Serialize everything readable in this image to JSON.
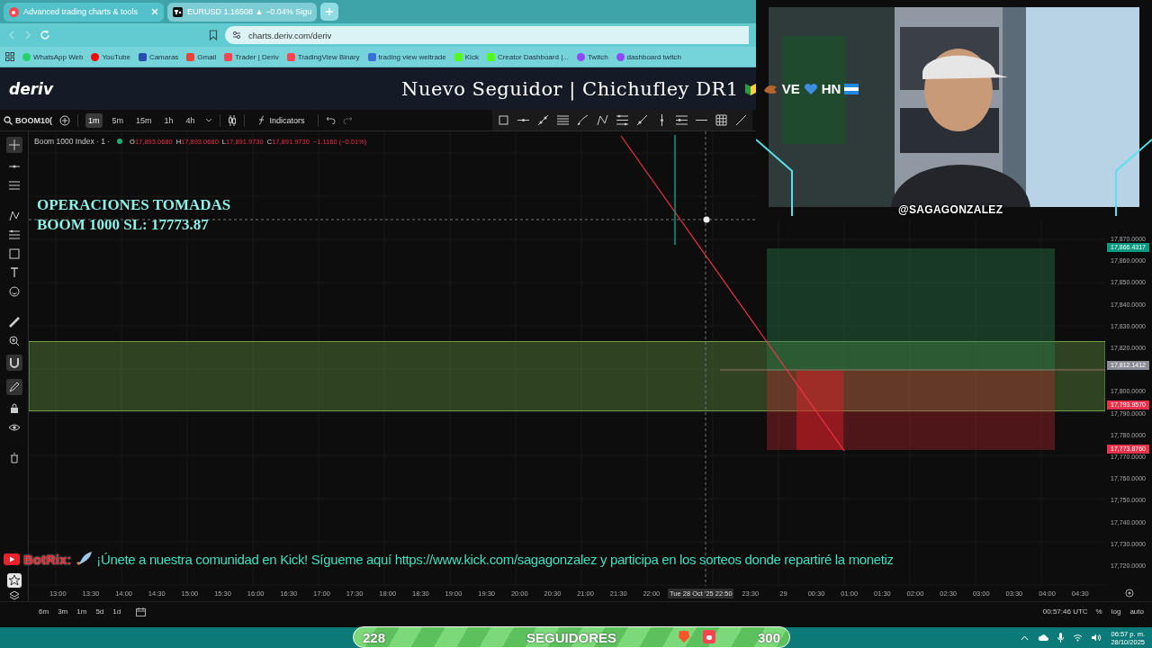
{
  "browser": {
    "tabs": [
      {
        "label": "Advanced trading charts & tools",
        "selected": true
      },
      {
        "label": "EURUSD 1.16508 ▲ −0.04% Sigu",
        "selected": false
      }
    ],
    "url": "charts.deriv.com/deriv",
    "bookmarks": [
      "WhatsApp Web",
      "YouTube",
      "Camaras",
      "Gmail",
      "Trader | Deriv",
      "TradingView Binary",
      "trading view weltrade",
      "Kick",
      "Creator Dashboard |...",
      "Twitch",
      "dashboard twitch"
    ]
  },
  "header": {
    "logo": "deriv",
    "alert": "Nuevo Seguidor | Chichufley DR1",
    "alert_tail": [
      "VE",
      "HN"
    ]
  },
  "toolbar": {
    "symbol": "BOOM10(",
    "intervals": [
      {
        "label": "1m",
        "selected": true
      },
      {
        "label": "5m",
        "selected": false
      },
      {
        "label": "15m",
        "selected": false
      },
      {
        "label": "1h",
        "selected": false
      },
      {
        "label": "4h",
        "selected": false
      }
    ],
    "indicators": "Indicators"
  },
  "legend": {
    "title": "Boom 1000 Index · 1 ·",
    "ohlc": [
      {
        "key": "O",
        "value": "17,893.0680"
      },
      {
        "key": "H",
        "value": "17,893.0680"
      },
      {
        "key": "L",
        "value": "17,891.9730"
      },
      {
        "key": "C",
        "value": "17,891.9730"
      }
    ],
    "change": "−1.1160 (−0.01%)"
  },
  "overlay_note": [
    "OPERACIONES TOMADAS",
    "BOOM 1000 SL: 17773.87"
  ],
  "webcam": {
    "kind": "picture",
    "handle": "@SAGAGONZALEZ"
  },
  "price_axis": {
    "ticks": [
      "17,870.0000",
      "17,860.0000",
      "17,850.0000",
      "17,840.0000",
      "17,830.0000",
      "17,820.0000",
      "17,800.0000",
      "17,790.0000",
      "17,780.0000",
      "17,770.0000",
      "17,760.0000",
      "17,750.0000",
      "17,740.0000",
      "17,730.0000",
      "17,720.0000"
    ],
    "tags": [
      {
        "value": "17,866.4317",
        "color": "#089981"
      },
      {
        "value": "17,812.1412",
        "color": "#8a8d96"
      },
      {
        "value": "17,793.9570",
        "color": "#e8314a"
      },
      {
        "value": "17,773.8760",
        "color": "#e8314a"
      }
    ]
  },
  "time_axis": {
    "ticks": [
      "13:00",
      "13:30",
      "14:00",
      "14:30",
      "15:00",
      "15:30",
      "16:00",
      "16:30",
      "17:00",
      "17:30",
      "18:00",
      "18:30",
      "19:00",
      "19:30",
      "20:00",
      "20:30",
      "21:00",
      "21:30",
      "22:00",
      "23:30",
      "29",
      "00:30",
      "01:00",
      "01:30",
      "02:00",
      "02:30",
      "03:00",
      "03:30",
      "04:00",
      "04:30"
    ],
    "cursor": "Tue 28 Oct '25   22:50"
  },
  "ticker": {
    "source": "BotRix:",
    "message": "¡Únete a nuestra comunidad en Kick! Sígueme aquí https://www.kick.com/sagagonzalez y participa en los sorteos donde repartiré la monetiz"
  },
  "bottom_bar": {
    "ranges": [
      "6m",
      "3m",
      "1m",
      "5d",
      "1d"
    ],
    "clock": "00:57:46 UTC",
    "scale": [
      "%",
      "log",
      "auto"
    ]
  },
  "taskbar": {
    "follower_count": "228",
    "follower_label": "SEGUIDORES",
    "follower_goal": "300",
    "time": "06:57 p. m.",
    "date": "28/10/2025"
  }
}
